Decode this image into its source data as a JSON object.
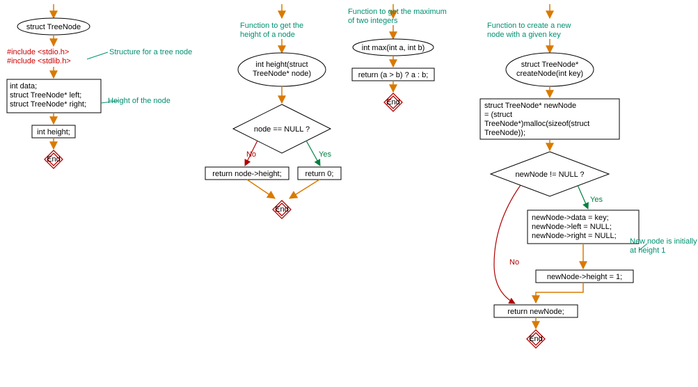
{
  "chart_data": {
    "type": "flowchart",
    "flows": [
      {
        "name": "struct-definition",
        "title": "struct TreeNode",
        "comment": "Structure for a tree node",
        "includes": [
          "#include <stdio.h>",
          "#include <stdlib.h>"
        ],
        "body": [
          "int data;",
          "struct TreeNode* left;",
          "struct TreeNode* right;"
        ],
        "extra": "int height;",
        "extra_comment": "Height of the node"
      },
      {
        "name": "height-function",
        "comment": "Function to get the height of a node",
        "signature": [
          "int height(struct",
          "TreeNode* node)"
        ],
        "decision": "node == NULL ?",
        "yes": "return 0;",
        "no": "return node->height;"
      },
      {
        "name": "max-function",
        "comment": "Function to get the maximum of two integers",
        "signature": "int max(int a, int b)",
        "body": "return (a > b) ? a : b;"
      },
      {
        "name": "createNode-function",
        "comment": "Function to create a new node with a given key",
        "signature": [
          "struct TreeNode*",
          "createNode(int key)"
        ],
        "alloc": [
          "struct TreeNode* newNode",
          "= (struct",
          "TreeNode*)malloc(sizeof(struct",
          "TreeNode));"
        ],
        "decision": "newNode != NULL ?",
        "yes_block": [
          "newNode->data = key;",
          "newNode->left = NULL;",
          "newNode->right = NULL;"
        ],
        "height_set": "newNode->height = 1;",
        "height_comment": "New node is initially at height 1",
        "return": "return newNode;"
      }
    ]
  },
  "c1": {
    "title": "struct TreeNode",
    "inc1": "#include <stdio.h>",
    "inc2": "#include <stdlib.h>",
    "comment": "Structure for a tree node",
    "body1": "int data;",
    "body2": "struct TreeNode* left;",
    "body3": "struct TreeNode* right;",
    "extra": "int height;",
    "extra_comment": "Height of the node",
    "end": "End"
  },
  "c2": {
    "comment1": "Function to get the",
    "comment2": "height of a node",
    "sig1": "int height(struct",
    "sig2": "TreeNode* node)",
    "decision": "node == NULL ?",
    "no_label": "No",
    "yes_label": "Yes",
    "yes": "return 0;",
    "no": "return node->height;",
    "end": "End"
  },
  "c3": {
    "comment1": "Function to get the maximum",
    "comment2": "of two integers",
    "sig": "int max(int a, int b)",
    "body": "return (a > b) ? a : b;",
    "end": "End"
  },
  "c4": {
    "comment1": "Function to create a new",
    "comment2": "node with a given key",
    "sig1": "struct TreeNode*",
    "sig2": "createNode(int key)",
    "alloc1": "struct TreeNode* newNode",
    "alloc2": "= (struct",
    "alloc3": "TreeNode*)malloc(sizeof(struct",
    "alloc4": "TreeNode));",
    "decision": "newNode != NULL ?",
    "no_label": "No",
    "yes_label": "Yes",
    "yes1": "newNode->data = key;",
    "yes2": "newNode->left = NULL;",
    "yes3": "newNode->right = NULL;",
    "hset": "newNode->height = 1;",
    "hcomment1": "New node is initially",
    "hcomment2": "at height 1",
    "ret": "return newNode;",
    "end": "End"
  }
}
